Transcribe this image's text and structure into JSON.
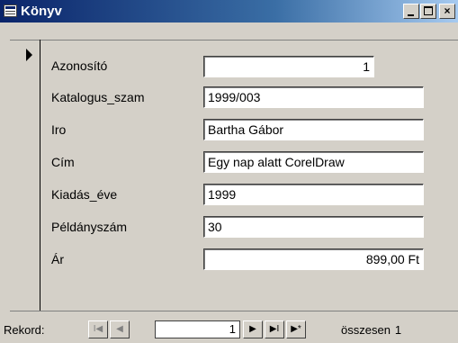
{
  "window": {
    "title": "Könyv",
    "minimize": "_",
    "close": "×"
  },
  "form": {
    "fields": [
      {
        "label": "Azonosító",
        "value": "1"
      },
      {
        "label": "Katalogus_szam",
        "value": "1999/003"
      },
      {
        "label": "Iro",
        "value": "Bartha Gábor"
      },
      {
        "label": "Cím",
        "value": "Egy nap alatt CorelDraw"
      },
      {
        "label": "Kiadás_éve",
        "value": "1999"
      },
      {
        "label": "Példányszám",
        "value": "30"
      },
      {
        "label": "Ár",
        "value": "899,00 Ft"
      }
    ]
  },
  "navigation": {
    "label": "Rekord:",
    "first": "I◀",
    "prev": "◀",
    "current": "1",
    "next": "▶",
    "last": "▶I",
    "new": "▶*",
    "total_label": "összesen",
    "total": "1"
  }
}
